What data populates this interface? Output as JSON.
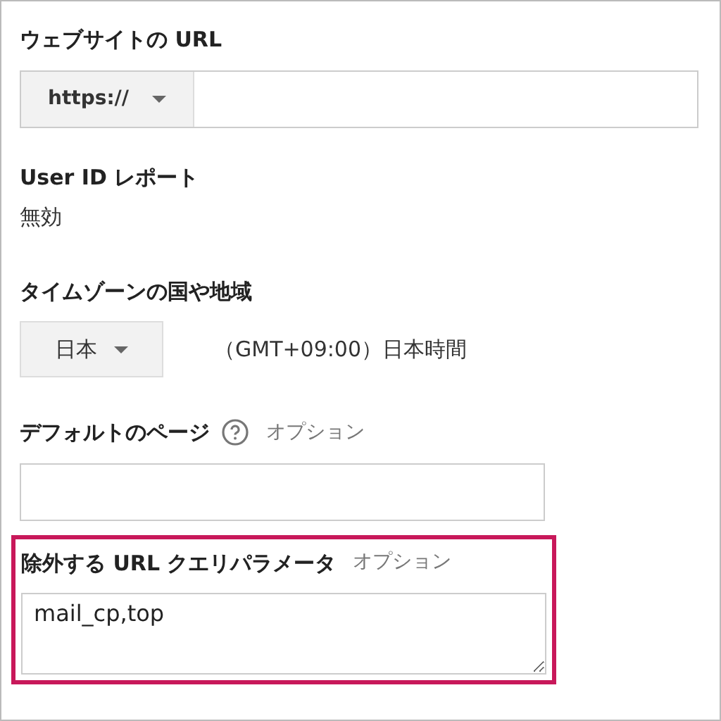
{
  "sections": [
    {
      "kind": "url",
      "label": "ウェブサイトの URL",
      "protocol": "https://",
      "highlighted": false
    },
    {
      "kind": "text",
      "label": "User ID レポート",
      "value": "無効",
      "highlighted": false
    },
    {
      "kind": "timezone",
      "label": "タイムゾーンの国や地域",
      "country": "日本",
      "zone": "（GMT+09:00）日本時間",
      "highlighted": false
    },
    {
      "kind": "input",
      "label": "デフォルトのページ",
      "help": true,
      "optional": "オプション",
      "highlighted": false
    },
    {
      "kind": "textarea",
      "label": "除外する URL クエリパラメータ",
      "optional": "オプション",
      "value": "mail_cp,top",
      "highlighted": true
    }
  ]
}
